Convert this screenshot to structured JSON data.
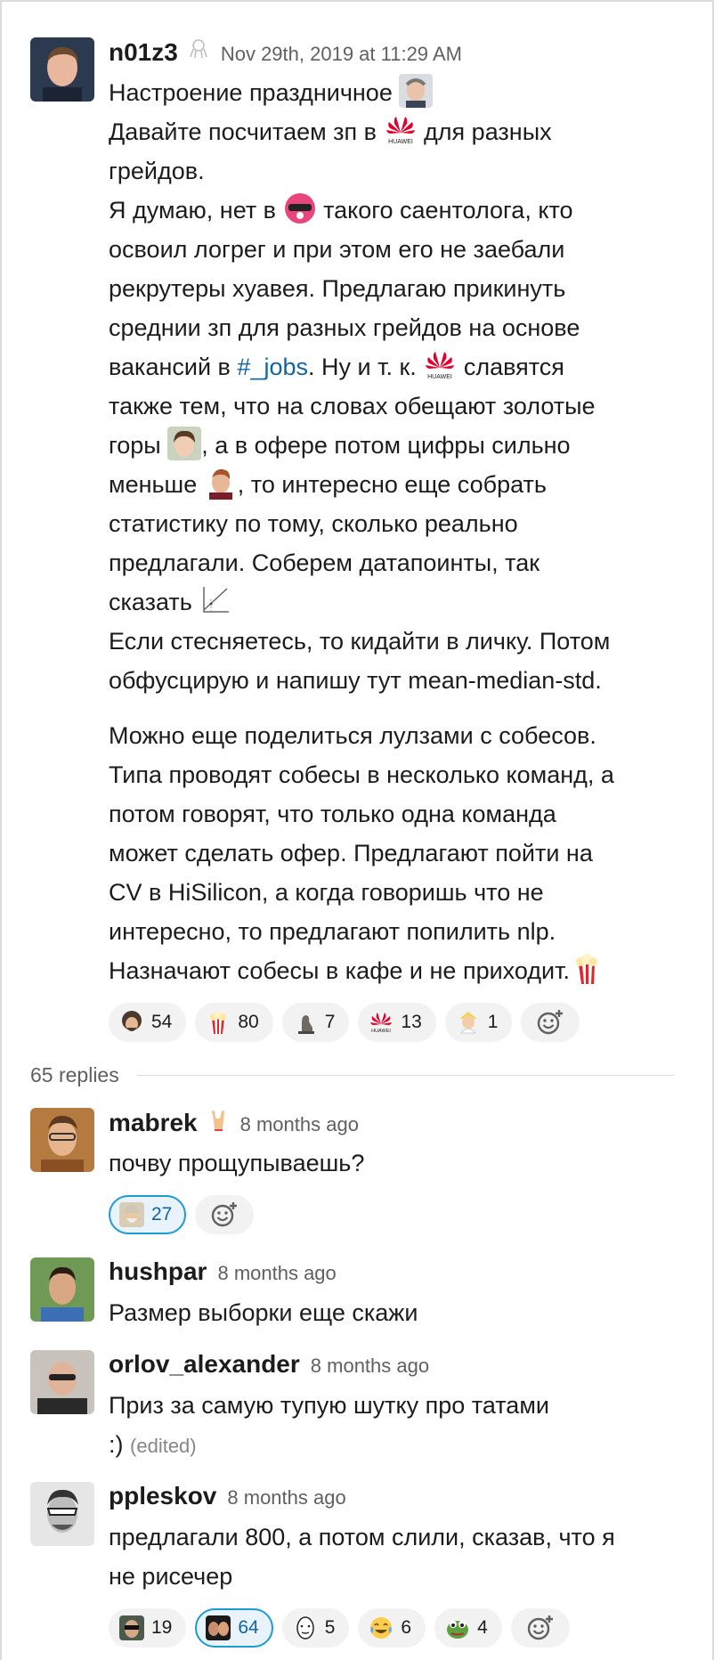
{
  "parent": {
    "author": "n01z3",
    "timestamp": "Nov 29th, 2019 at 11:29 AM",
    "lines": [
      "Настроение праздничное",
      "Давайте посчитаем зп в",
      "для разных",
      "грейдов.",
      "Я думаю, нет в",
      "такого саентолога, кто",
      "освоил логрег и при этом его не заебали",
      "рекрутеры хуавея. Предлагаю прикинуть",
      "среднии зп для разных грейдов на основе",
      "вакансий в",
      "#_jobs",
      ". Ну и т. к.",
      "славятся",
      "также тем, что на словах обещают золотые",
      "горы",
      ", а в офере потом цифры сильно",
      "меньше",
      ", то интересно еще собрать",
      "статистику по тому, сколько реально",
      "предлагали. Соберем датапоинты, так",
      "сказать",
      "Если стесняетесь, то кидайти в личку. Потом",
      "обфусцирую и напишу тут mean-median-std."
    ],
    "paragraph2": [
      "Можно еще поделиться лулзами с собесов.",
      "Типа проводят собесы в несколько команд, а",
      "потом говорят, что только одна команда",
      "может сделать офер. Предлагают пойти на",
      "CV в HiSilicon, а когда говоришь что не",
      "интересно, то предлагают попилить nlp.",
      "Назначают собесы в кафе и не приходит."
    ],
    "reactions": [
      {
        "emoji": "bob-ross-face",
        "count": "54"
      },
      {
        "emoji": "popcorn",
        "count": "80"
      },
      {
        "emoji": "statue",
        "count": "7"
      },
      {
        "emoji": "huawei-logo",
        "count": "13"
      },
      {
        "emoji": "blond-guy",
        "count": "1"
      }
    ]
  },
  "replies_label": "65 replies",
  "replies": [
    {
      "author": "mabrek",
      "time": "8 months ago",
      "text": "почву прощупываешь?",
      "reactions": [
        {
          "emoji": "old-man-face",
          "count": "27",
          "mine": true
        }
      ]
    },
    {
      "author": "hushpar",
      "time": "8 months ago",
      "text": "Размер выборки еще скажи"
    },
    {
      "author": "orlov_alexander",
      "time": "8 months ago",
      "text_line1": "Приз за самую тупую шутку про татами",
      "text_line2": ":)",
      "edited": "(edited)"
    },
    {
      "author": "ppleskov",
      "time": "8 months ago",
      "text_line1": "предлагали 800, а потом слили, сказав, что я",
      "text_line2": "не рисечер",
      "reactions": [
        {
          "emoji": "sunglasses-man",
          "count": "19",
          "mine": false
        },
        {
          "emoji": "two-faces",
          "count": "64",
          "mine": true
        },
        {
          "emoji": "bald-man-face",
          "count": "5",
          "mine": false
        },
        {
          "emoji": "joy",
          "count": "6",
          "mine": false
        },
        {
          "emoji": "pepe-frog",
          "count": "4",
          "mine": false
        }
      ]
    }
  ],
  "colors": {
    "link": "#1264a3",
    "mine_border": "#1d9bd1",
    "muted": "#616061"
  }
}
